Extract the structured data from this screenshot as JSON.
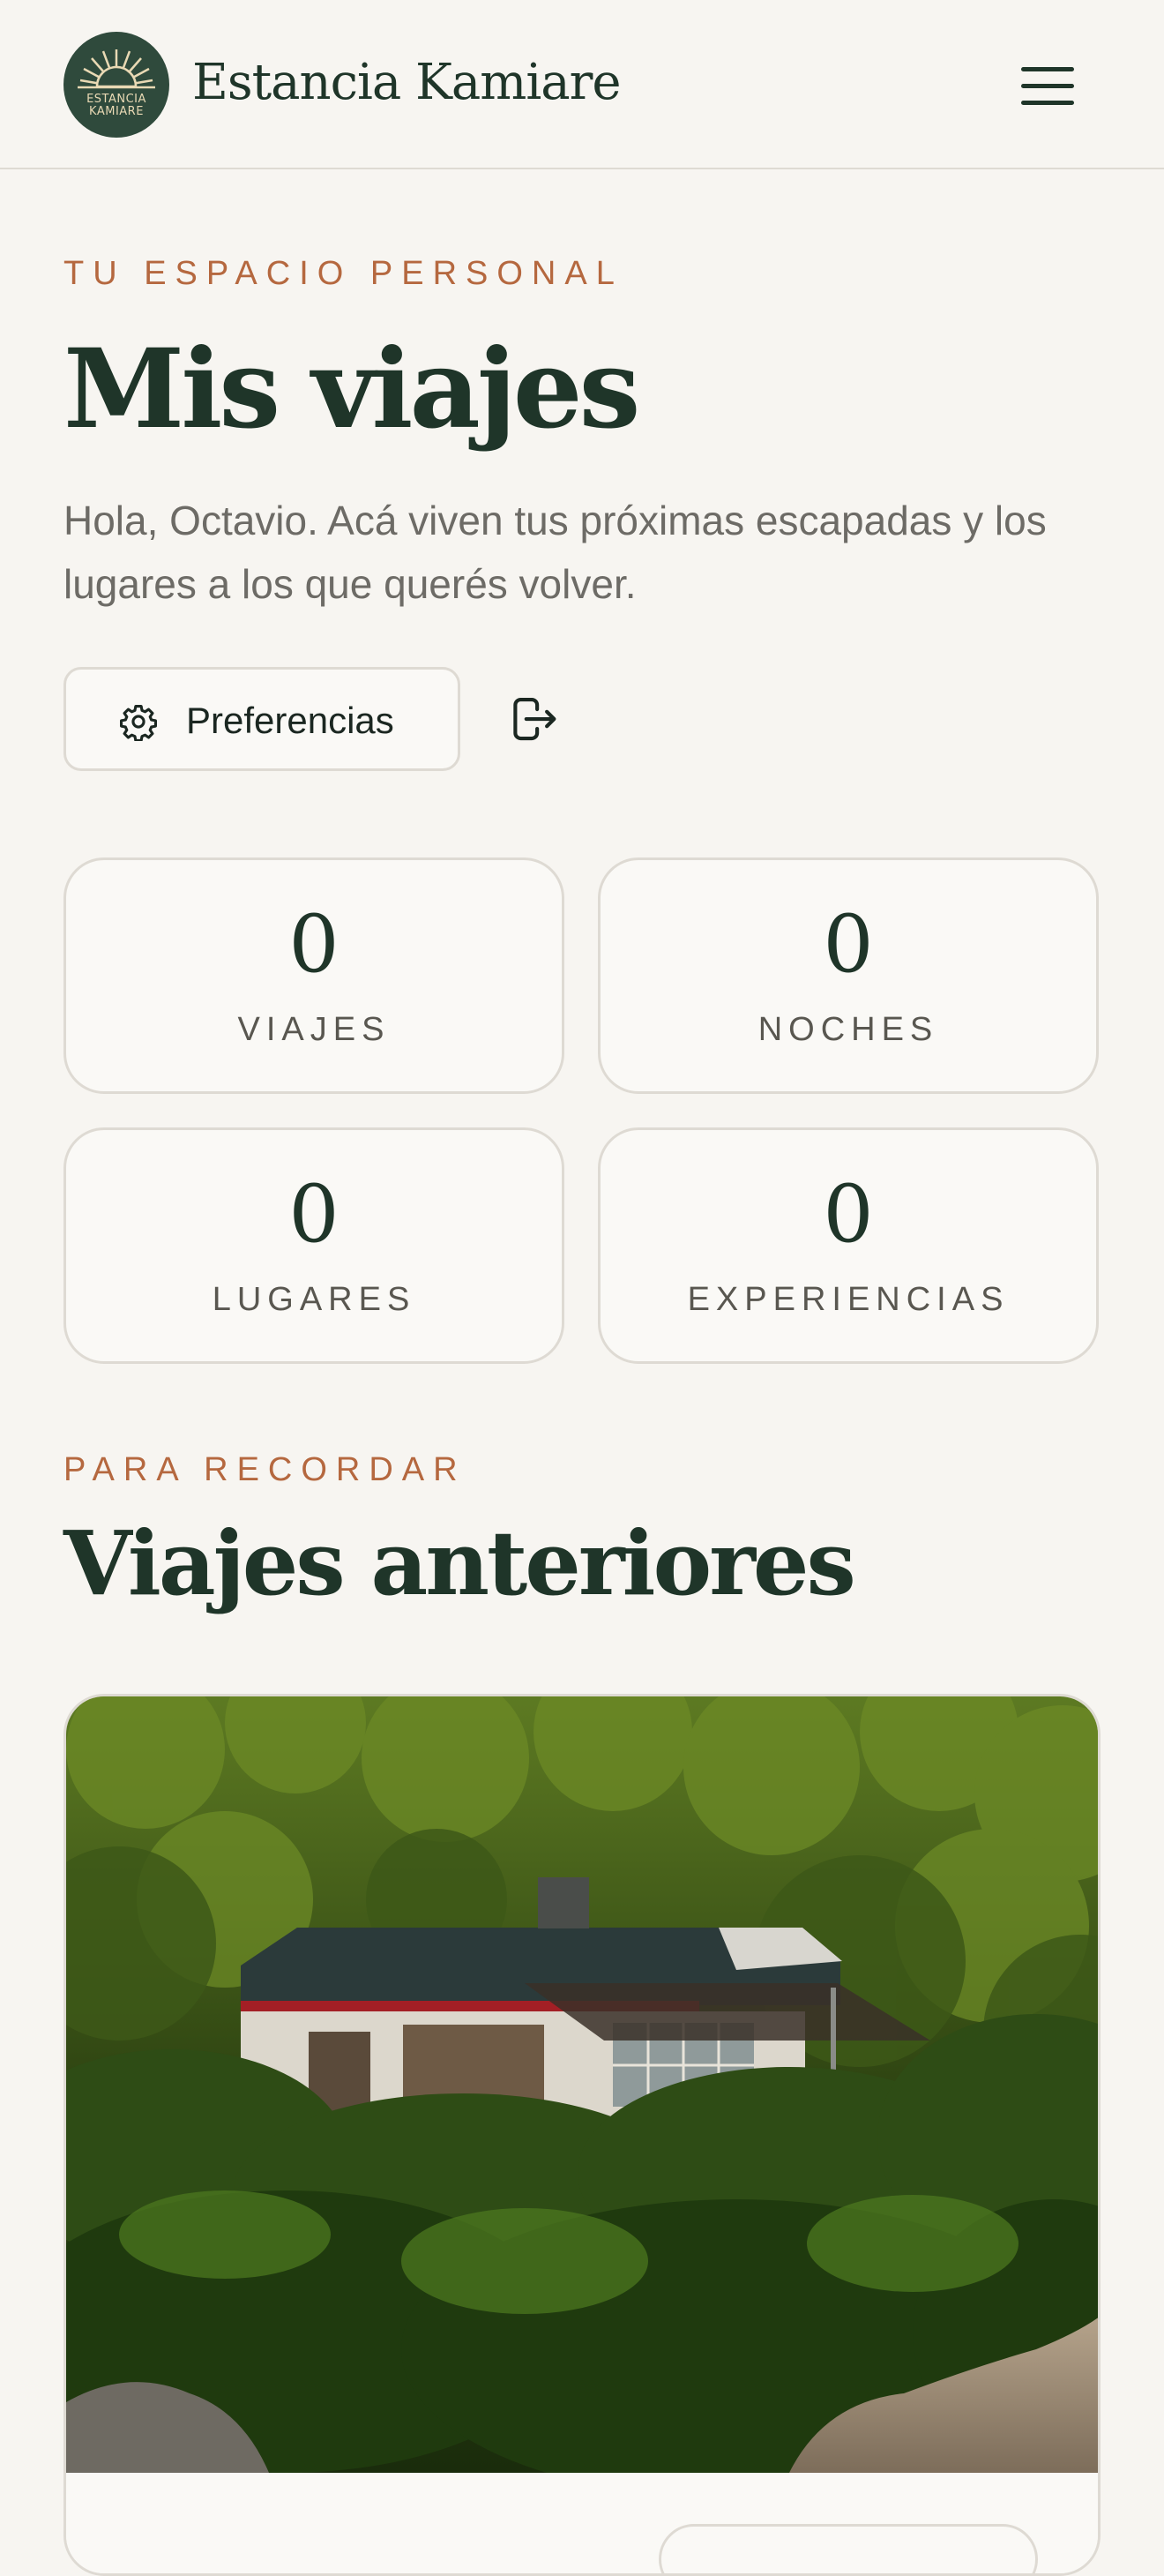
{
  "header": {
    "brand": "Estancia Kamiare",
    "logo_text_top": "ESTANCIA",
    "logo_text_bottom": "KAMIARE",
    "menu_icon": "hamburger-menu-icon"
  },
  "hero": {
    "eyebrow": "TU ESPACIO PERSONAL",
    "title": "Mis viajes",
    "intro": "Hola, Octavio. Acá viven tus próximas escapadas y los lugares a los que querés volver."
  },
  "actions": {
    "preferences_label": "Preferencias",
    "preferences_icon": "gear-icon",
    "logout_icon": "logout-icon"
  },
  "stats": [
    {
      "value": "0",
      "label": "VIAJES"
    },
    {
      "value": "0",
      "label": "NOCHES"
    },
    {
      "value": "0",
      "label": "LUGARES"
    },
    {
      "value": "0",
      "label": "EXPERIENCIAS"
    }
  ],
  "past": {
    "eyebrow": "PARA RECORDAR",
    "title": "Viajes anteriores"
  },
  "colors": {
    "background": "#f7f5f1",
    "primary": "#1f3529",
    "accent": "#b5683f",
    "muted_text": "#6d6b66",
    "border": "#dedad3"
  }
}
